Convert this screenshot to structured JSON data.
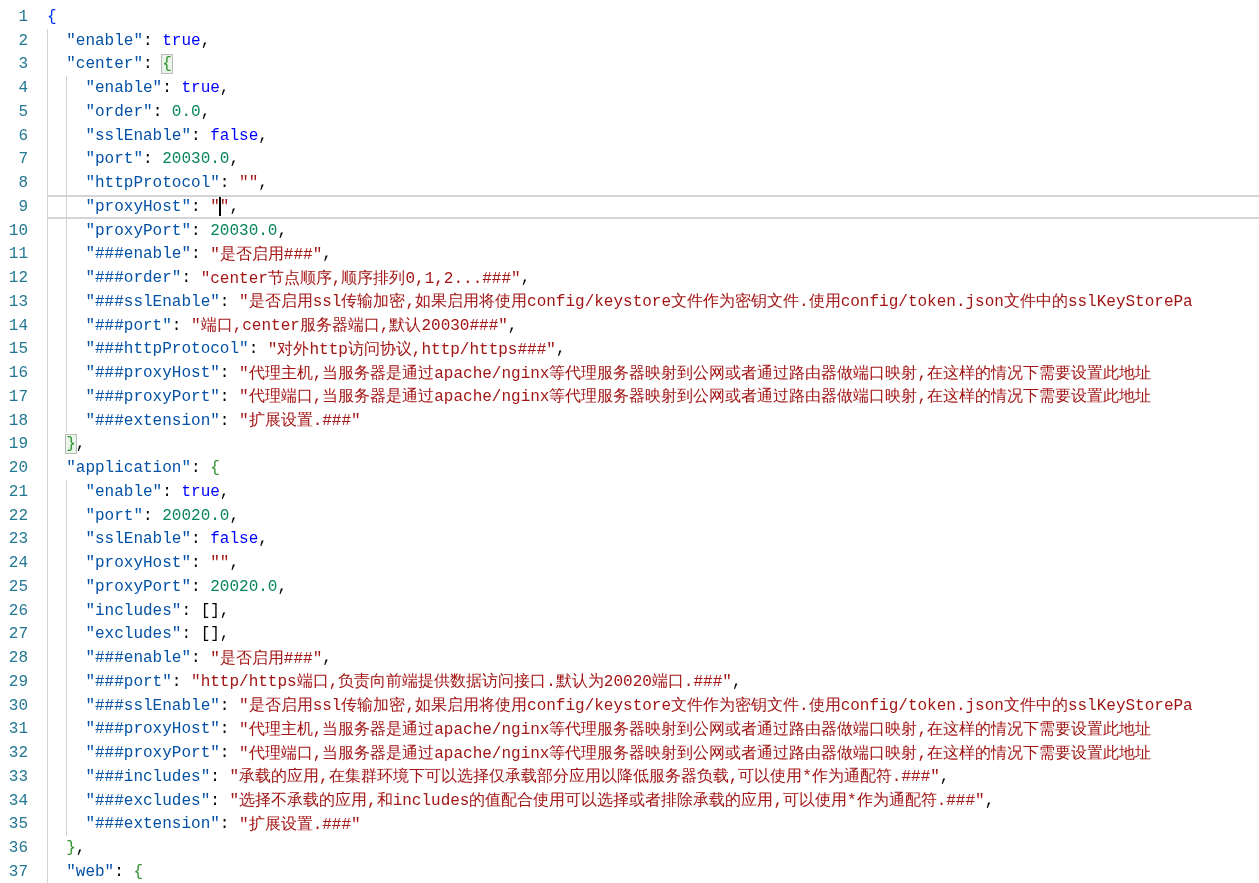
{
  "lines": [
    {
      "number": "1",
      "current": false,
      "segments": [
        {
          "kind": "brace",
          "text": "{",
          "color": "#0431fa",
          "matched": false
        }
      ]
    },
    {
      "number": "2",
      "current": false,
      "segments": [
        {
          "kind": "guide"
        },
        {
          "kind": "key",
          "text": "\"enable\""
        },
        {
          "kind": "punct",
          "text": ": "
        },
        {
          "kind": "bool",
          "text": "true"
        },
        {
          "kind": "punct",
          "text": ","
        }
      ]
    },
    {
      "number": "3",
      "current": false,
      "segments": [
        {
          "kind": "guide"
        },
        {
          "kind": "key",
          "text": "\"center\""
        },
        {
          "kind": "punct",
          "text": ": "
        },
        {
          "kind": "brace",
          "text": "{",
          "color": "#319331",
          "matched": true
        }
      ]
    },
    {
      "number": "4",
      "current": false,
      "segments": [
        {
          "kind": "guide"
        },
        {
          "kind": "guide"
        },
        {
          "kind": "key",
          "text": "\"enable\""
        },
        {
          "kind": "punct",
          "text": ": "
        },
        {
          "kind": "bool",
          "text": "true"
        },
        {
          "kind": "punct",
          "text": ","
        }
      ]
    },
    {
      "number": "5",
      "current": false,
      "segments": [
        {
          "kind": "guide"
        },
        {
          "kind": "guide"
        },
        {
          "kind": "key",
          "text": "\"order\""
        },
        {
          "kind": "punct",
          "text": ": "
        },
        {
          "kind": "number",
          "text": "0.0"
        },
        {
          "kind": "punct",
          "text": ","
        }
      ]
    },
    {
      "number": "6",
      "current": false,
      "segments": [
        {
          "kind": "guide"
        },
        {
          "kind": "guide"
        },
        {
          "kind": "key",
          "text": "\"sslEnable\""
        },
        {
          "kind": "punct",
          "text": ": "
        },
        {
          "kind": "bool",
          "text": "false"
        },
        {
          "kind": "punct",
          "text": ","
        }
      ]
    },
    {
      "number": "7",
      "current": false,
      "segments": [
        {
          "kind": "guide"
        },
        {
          "kind": "guide"
        },
        {
          "kind": "key",
          "text": "\"port\""
        },
        {
          "kind": "punct",
          "text": ": "
        },
        {
          "kind": "number",
          "text": "20030.0"
        },
        {
          "kind": "punct",
          "text": ","
        }
      ]
    },
    {
      "number": "8",
      "current": false,
      "segments": [
        {
          "kind": "guide"
        },
        {
          "kind": "guide"
        },
        {
          "kind": "key",
          "text": "\"httpProtocol\""
        },
        {
          "kind": "punct",
          "text": ": "
        },
        {
          "kind": "string",
          "text": "\"\""
        },
        {
          "kind": "punct",
          "text": ","
        }
      ]
    },
    {
      "number": "9",
      "current": true,
      "segments": [
        {
          "kind": "guide"
        },
        {
          "kind": "guide"
        },
        {
          "kind": "key",
          "text": "\"proxyHost\""
        },
        {
          "kind": "punct",
          "text": ": "
        },
        {
          "kind": "string",
          "text": "\""
        },
        {
          "kind": "cursor"
        },
        {
          "kind": "string",
          "text": "\""
        },
        {
          "kind": "punct",
          "text": ","
        }
      ]
    },
    {
      "number": "10",
      "current": false,
      "segments": [
        {
          "kind": "guide"
        },
        {
          "kind": "guide"
        },
        {
          "kind": "key",
          "text": "\"proxyPort\""
        },
        {
          "kind": "punct",
          "text": ": "
        },
        {
          "kind": "number",
          "text": "20030.0"
        },
        {
          "kind": "punct",
          "text": ","
        }
      ]
    },
    {
      "number": "11",
      "current": false,
      "segments": [
        {
          "kind": "guide"
        },
        {
          "kind": "guide"
        },
        {
          "kind": "key",
          "text": "\"###enable\""
        },
        {
          "kind": "punct",
          "text": ": "
        },
        {
          "kind": "string",
          "text": "\"是否启用###\""
        },
        {
          "kind": "punct",
          "text": ","
        }
      ]
    },
    {
      "number": "12",
      "current": false,
      "segments": [
        {
          "kind": "guide"
        },
        {
          "kind": "guide"
        },
        {
          "kind": "key",
          "text": "\"###order\""
        },
        {
          "kind": "punct",
          "text": ": "
        },
        {
          "kind": "string",
          "text": "\"center节点顺序,顺序排列0,1,2...###\""
        },
        {
          "kind": "punct",
          "text": ","
        }
      ]
    },
    {
      "number": "13",
      "current": false,
      "segments": [
        {
          "kind": "guide"
        },
        {
          "kind": "guide"
        },
        {
          "kind": "key",
          "text": "\"###sslEnable\""
        },
        {
          "kind": "punct",
          "text": ": "
        },
        {
          "kind": "string",
          "text": "\"是否启用ssl传输加密,如果启用将使用config/keystore文件作为密钥文件.使用config/token.json文件中的sslKeyStorePa"
        }
      ]
    },
    {
      "number": "14",
      "current": false,
      "segments": [
        {
          "kind": "guide"
        },
        {
          "kind": "guide"
        },
        {
          "kind": "key",
          "text": "\"###port\""
        },
        {
          "kind": "punct",
          "text": ": "
        },
        {
          "kind": "string",
          "text": "\"端口,center服务器端口,默认20030###\""
        },
        {
          "kind": "punct",
          "text": ","
        }
      ]
    },
    {
      "number": "15",
      "current": false,
      "segments": [
        {
          "kind": "guide"
        },
        {
          "kind": "guide"
        },
        {
          "kind": "key",
          "text": "\"###httpProtocol\""
        },
        {
          "kind": "punct",
          "text": ": "
        },
        {
          "kind": "string",
          "text": "\"对外http访问协议,http/https###\""
        },
        {
          "kind": "punct",
          "text": ","
        }
      ]
    },
    {
      "number": "16",
      "current": false,
      "segments": [
        {
          "kind": "guide"
        },
        {
          "kind": "guide"
        },
        {
          "kind": "key",
          "text": "\"###proxyHost\""
        },
        {
          "kind": "punct",
          "text": ": "
        },
        {
          "kind": "string",
          "text": "\"代理主机,当服务器是通过apache/nginx等代理服务器映射到公网或者通过路由器做端口映射,在这样的情况下需要设置此地址"
        }
      ]
    },
    {
      "number": "17",
      "current": false,
      "segments": [
        {
          "kind": "guide"
        },
        {
          "kind": "guide"
        },
        {
          "kind": "key",
          "text": "\"###proxyPort\""
        },
        {
          "kind": "punct",
          "text": ": "
        },
        {
          "kind": "string",
          "text": "\"代理端口,当服务器是通过apache/nginx等代理服务器映射到公网或者通过路由器做端口映射,在这样的情况下需要设置此地址"
        }
      ]
    },
    {
      "number": "18",
      "current": false,
      "segments": [
        {
          "kind": "guide"
        },
        {
          "kind": "guide"
        },
        {
          "kind": "key",
          "text": "\"###extension\""
        },
        {
          "kind": "punct",
          "text": ": "
        },
        {
          "kind": "string",
          "text": "\"扩展设置.###\""
        }
      ]
    },
    {
      "number": "19",
      "current": false,
      "segments": [
        {
          "kind": "guide"
        },
        {
          "kind": "brace",
          "text": "}",
          "color": "#319331",
          "matched": true
        },
        {
          "kind": "punct",
          "text": ","
        }
      ]
    },
    {
      "number": "20",
      "current": false,
      "segments": [
        {
          "kind": "guide"
        },
        {
          "kind": "key",
          "text": "\"application\""
        },
        {
          "kind": "punct",
          "text": ": "
        },
        {
          "kind": "brace",
          "text": "{",
          "color": "#319331",
          "matched": false
        }
      ]
    },
    {
      "number": "21",
      "current": false,
      "segments": [
        {
          "kind": "guide"
        },
        {
          "kind": "guide"
        },
        {
          "kind": "key",
          "text": "\"enable\""
        },
        {
          "kind": "punct",
          "text": ": "
        },
        {
          "kind": "bool",
          "text": "true"
        },
        {
          "kind": "punct",
          "text": ","
        }
      ]
    },
    {
      "number": "22",
      "current": false,
      "segments": [
        {
          "kind": "guide"
        },
        {
          "kind": "guide"
        },
        {
          "kind": "key",
          "text": "\"port\""
        },
        {
          "kind": "punct",
          "text": ": "
        },
        {
          "kind": "number",
          "text": "20020.0"
        },
        {
          "kind": "punct",
          "text": ","
        }
      ]
    },
    {
      "number": "23",
      "current": false,
      "segments": [
        {
          "kind": "guide"
        },
        {
          "kind": "guide"
        },
        {
          "kind": "key",
          "text": "\"sslEnable\""
        },
        {
          "kind": "punct",
          "text": ": "
        },
        {
          "kind": "bool",
          "text": "false"
        },
        {
          "kind": "punct",
          "text": ","
        }
      ]
    },
    {
      "number": "24",
      "current": false,
      "segments": [
        {
          "kind": "guide"
        },
        {
          "kind": "guide"
        },
        {
          "kind": "key",
          "text": "\"proxyHost\""
        },
        {
          "kind": "punct",
          "text": ": "
        },
        {
          "kind": "string",
          "text": "\"\""
        },
        {
          "kind": "punct",
          "text": ","
        }
      ]
    },
    {
      "number": "25",
      "current": false,
      "segments": [
        {
          "kind": "guide"
        },
        {
          "kind": "guide"
        },
        {
          "kind": "key",
          "text": "\"proxyPort\""
        },
        {
          "kind": "punct",
          "text": ": "
        },
        {
          "kind": "number",
          "text": "20020.0"
        },
        {
          "kind": "punct",
          "text": ","
        }
      ]
    },
    {
      "number": "26",
      "current": false,
      "segments": [
        {
          "kind": "guide"
        },
        {
          "kind": "guide"
        },
        {
          "kind": "key",
          "text": "\"includes\""
        },
        {
          "kind": "punct",
          "text": ": [],"
        }
      ]
    },
    {
      "number": "27",
      "current": false,
      "segments": [
        {
          "kind": "guide"
        },
        {
          "kind": "guide"
        },
        {
          "kind": "key",
          "text": "\"excludes\""
        },
        {
          "kind": "punct",
          "text": ": [],"
        }
      ]
    },
    {
      "number": "28",
      "current": false,
      "segments": [
        {
          "kind": "guide"
        },
        {
          "kind": "guide"
        },
        {
          "kind": "key",
          "text": "\"###enable\""
        },
        {
          "kind": "punct",
          "text": ": "
        },
        {
          "kind": "string",
          "text": "\"是否启用###\""
        },
        {
          "kind": "punct",
          "text": ","
        }
      ]
    },
    {
      "number": "29",
      "current": false,
      "segments": [
        {
          "kind": "guide"
        },
        {
          "kind": "guide"
        },
        {
          "kind": "key",
          "text": "\"###port\""
        },
        {
          "kind": "punct",
          "text": ": "
        },
        {
          "kind": "string",
          "text": "\"http/https端口,负责向前端提供数据访问接口.默认为20020端口.###\""
        },
        {
          "kind": "punct",
          "text": ","
        }
      ]
    },
    {
      "number": "30",
      "current": false,
      "segments": [
        {
          "kind": "guide"
        },
        {
          "kind": "guide"
        },
        {
          "kind": "key",
          "text": "\"###sslEnable\""
        },
        {
          "kind": "punct",
          "text": ": "
        },
        {
          "kind": "string",
          "text": "\"是否启用ssl传输加密,如果启用将使用config/keystore文件作为密钥文件.使用config/token.json文件中的sslKeyStorePa"
        }
      ]
    },
    {
      "number": "31",
      "current": false,
      "segments": [
        {
          "kind": "guide"
        },
        {
          "kind": "guide"
        },
        {
          "kind": "key",
          "text": "\"###proxyHost\""
        },
        {
          "kind": "punct",
          "text": ": "
        },
        {
          "kind": "string",
          "text": "\"代理主机,当服务器是通过apache/nginx等代理服务器映射到公网或者通过路由器做端口映射,在这样的情况下需要设置此地址"
        }
      ]
    },
    {
      "number": "32",
      "current": false,
      "segments": [
        {
          "kind": "guide"
        },
        {
          "kind": "guide"
        },
        {
          "kind": "key",
          "text": "\"###proxyPort\""
        },
        {
          "kind": "punct",
          "text": ": "
        },
        {
          "kind": "string",
          "text": "\"代理端口,当服务器是通过apache/nginx等代理服务器映射到公网或者通过路由器做端口映射,在这样的情况下需要设置此地址"
        }
      ]
    },
    {
      "number": "33",
      "current": false,
      "segments": [
        {
          "kind": "guide"
        },
        {
          "kind": "guide"
        },
        {
          "kind": "key",
          "text": "\"###includes\""
        },
        {
          "kind": "punct",
          "text": ": "
        },
        {
          "kind": "string",
          "text": "\"承载的应用,在集群环境下可以选择仅承载部分应用以降低服务器负载,可以使用*作为通配符.###\""
        },
        {
          "kind": "punct",
          "text": ","
        }
      ]
    },
    {
      "number": "34",
      "current": false,
      "segments": [
        {
          "kind": "guide"
        },
        {
          "kind": "guide"
        },
        {
          "kind": "key",
          "text": "\"###excludes\""
        },
        {
          "kind": "punct",
          "text": ": "
        },
        {
          "kind": "string",
          "text": "\"选择不承载的应用,和includes的值配合使用可以选择或者排除承载的应用,可以使用*作为通配符.###\""
        },
        {
          "kind": "punct",
          "text": ","
        }
      ]
    },
    {
      "number": "35",
      "current": false,
      "segments": [
        {
          "kind": "guide"
        },
        {
          "kind": "guide"
        },
        {
          "kind": "key",
          "text": "\"###extension\""
        },
        {
          "kind": "punct",
          "text": ": "
        },
        {
          "kind": "string",
          "text": "\"扩展设置.###\""
        }
      ]
    },
    {
      "number": "36",
      "current": false,
      "segments": [
        {
          "kind": "guide"
        },
        {
          "kind": "brace",
          "text": "}",
          "color": "#319331",
          "matched": false
        },
        {
          "kind": "punct",
          "text": ","
        }
      ]
    },
    {
      "number": "37",
      "current": false,
      "segments": [
        {
          "kind": "guide"
        },
        {
          "kind": "key",
          "text": "\"web\""
        },
        {
          "kind": "punct",
          "text": ": "
        },
        {
          "kind": "brace",
          "text": "{",
          "color": "#319331",
          "matched": false
        }
      ]
    }
  ]
}
